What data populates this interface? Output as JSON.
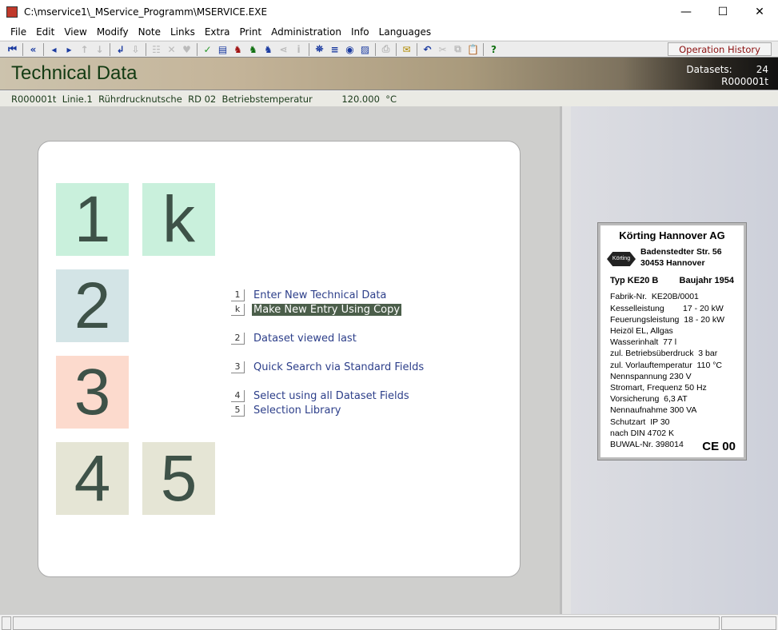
{
  "window": {
    "title": "C:\\mservice1\\_MService_Programm\\MSERVICE.EXE",
    "minimize": "—",
    "maximize": "☐",
    "close": "✕"
  },
  "menu": [
    "File",
    "Edit",
    "View",
    "Modify",
    "Note",
    "Links",
    "Extra",
    "Print",
    "Administration",
    "Info",
    "Languages"
  ],
  "toolbar": {
    "icons": [
      {
        "name": "first-record-icon",
        "g": "⏮"
      },
      {
        "sep": true
      },
      {
        "name": "previous-page-icon",
        "g": "«"
      },
      {
        "sep": true
      },
      {
        "name": "previous-record-icon",
        "g": "◂"
      },
      {
        "name": "next-record-icon",
        "g": "▸"
      },
      {
        "name": "arrow-up-icon",
        "g": "↑",
        "dis": true
      },
      {
        "name": "arrow-down-icon",
        "g": "↓",
        "dis": true
      },
      {
        "sep": true
      },
      {
        "name": "enter-icon",
        "g": "↲"
      },
      {
        "name": "import-icon",
        "g": "⇩",
        "dis": true
      },
      {
        "sep": true
      },
      {
        "name": "tree-icon",
        "g": "☷",
        "dis": true
      },
      {
        "name": "delete-icon",
        "g": "✕",
        "dis": true
      },
      {
        "name": "favorite-icon",
        "g": "♥",
        "dis": true
      },
      {
        "sep": true
      },
      {
        "name": "check-icon",
        "g": "✓"
      },
      {
        "name": "document-icon",
        "g": "▤"
      },
      {
        "name": "squirrel-red-icon",
        "g": "♞"
      },
      {
        "name": "squirrel-green-icon",
        "g": "♞"
      },
      {
        "name": "squirrel-blue-icon",
        "g": "♞"
      },
      {
        "name": "link-icon",
        "g": "⋖",
        "dis": true
      },
      {
        "name": "info-icon",
        "g": "i",
        "dis": true
      },
      {
        "sep": true
      },
      {
        "name": "binoculars-icon",
        "g": "⛯"
      },
      {
        "name": "list-icon",
        "g": "≡"
      },
      {
        "name": "eye-icon",
        "g": "◉"
      },
      {
        "name": "image-icon",
        "g": "▨"
      },
      {
        "sep": true
      },
      {
        "name": "print-icon",
        "g": "⎙",
        "dis": true
      },
      {
        "sep": true
      },
      {
        "name": "mail-icon",
        "g": "✉"
      },
      {
        "sep": true
      },
      {
        "name": "undo-icon",
        "g": "↶"
      },
      {
        "name": "cut-icon",
        "g": "✂",
        "dis": true
      },
      {
        "name": "copy-icon",
        "g": "⧉",
        "dis": true
      },
      {
        "name": "paste-icon",
        "g": "📋",
        "dis": true
      },
      {
        "sep": true
      },
      {
        "name": "help-icon",
        "g": "?"
      }
    ],
    "operation_history": "Operation History"
  },
  "header": {
    "title": "Technical Data",
    "datasets_label": "Datasets:",
    "datasets_count": "24",
    "record_id": "R000001t"
  },
  "infoline": "R000001t  Linie.1  Rührdrucknutsche  RD 02  Betriebstemperatur          120.000  °C",
  "tiles": {
    "t1": "1",
    "tk": "k",
    "t2": "2",
    "t3": "3",
    "t4": "4",
    "t5": "5"
  },
  "entries": [
    {
      "key": "1",
      "label": "Enter New Technical Data"
    },
    {
      "key": "k",
      "label": "Make New Entry Using Copy"
    },
    {
      "key": "2",
      "label": "Dataset viewed last"
    },
    {
      "key": "3",
      "label": "Quick Search via Standard Fields"
    },
    {
      "key": "4",
      "label": "Select using all Dataset Fields"
    },
    {
      "key": "5",
      "label": "Selection Library"
    }
  ],
  "plate": {
    "company": "Körting Hannover AG",
    "logo": "Körting",
    "street": "Badenstedter Str. 56",
    "city": "30453 Hannover",
    "typ": "Typ KE20 B",
    "baujahr": "Baujahr 1954",
    "lines": [
      "Fabrik-Nr.  KE20B/0001",
      "Kesselleistung        17 - 20 kW",
      "Feuerungsleistung  18 - 20 kW",
      "Heizöl EL, Allgas",
      "Wasserinhalt  77 l",
      "zul. Betriebsüberdruck  3 bar",
      "zul. Vorlauftemperatur  110 °C",
      "Nennspannung 230 V",
      "Stromart, Frequenz 50 Hz",
      "Vorsicherung  6,3 AT",
      "Nennaufnahme 300 VA",
      "Schutzart  IP 30",
      "nach DIN 4702 K",
      "BUWAL-Nr. 398014"
    ],
    "ce": "CE 00"
  }
}
